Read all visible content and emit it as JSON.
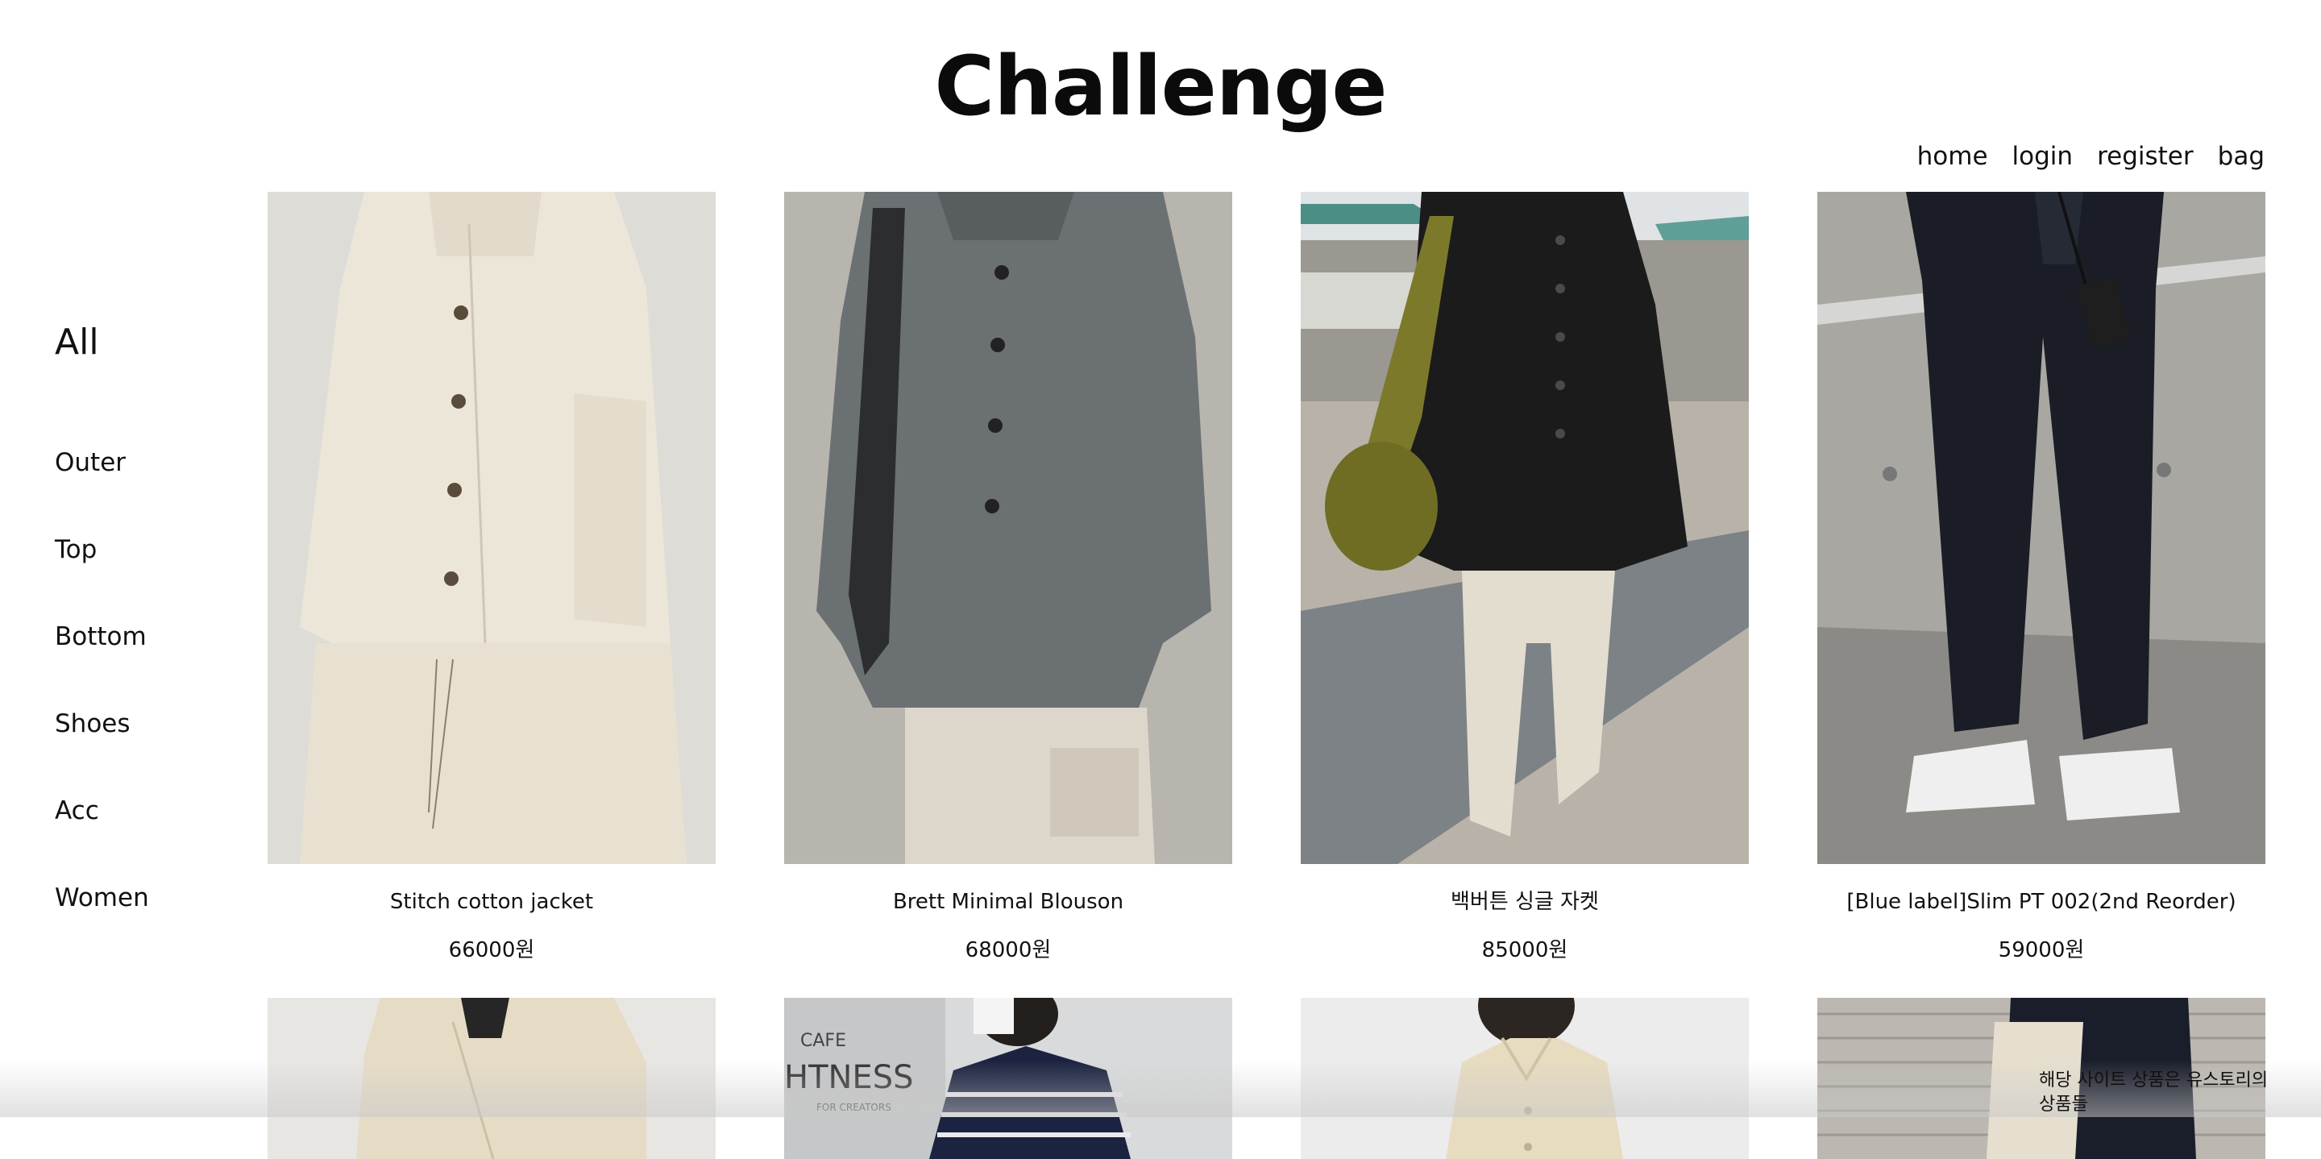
{
  "header": {
    "title": "Challenge"
  },
  "nav": {
    "home": "home",
    "login": "login",
    "register": "register",
    "bag": "bag"
  },
  "sidebar": {
    "items": [
      {
        "label": "All"
      },
      {
        "label": "Outer"
      },
      {
        "label": "Top"
      },
      {
        "label": "Bottom"
      },
      {
        "label": "Shoes"
      },
      {
        "label": "Acc"
      },
      {
        "label": "Women"
      }
    ]
  },
  "products": [
    {
      "name": "Stitch cotton jacket",
      "price": "66000원"
    },
    {
      "name": "Brett Minimal Blouson",
      "price": "68000원"
    },
    {
      "name": "백버튼 싱글 자켓",
      "price": "85000원"
    },
    {
      "name": "[Blue label]Slim PT 002(2nd Reorder)",
      "price": "59000원"
    }
  ],
  "extra_photos": {
    "cafe_sign": "CAFE",
    "cafe_word": "HTNESS",
    "cafe_sub": "FOR CREATORS"
  },
  "notice": {
    "line1": "해당 사이트 상품은 유스토리의",
    "line2": "상품들"
  },
  "colors": {
    "accent": "#0b0b0b",
    "background": "#ffffff"
  }
}
